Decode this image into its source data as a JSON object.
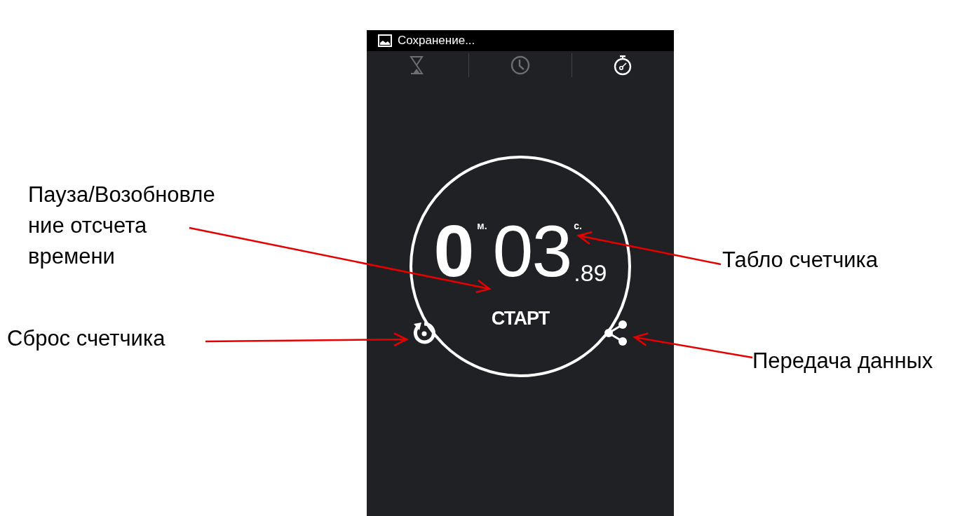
{
  "status_bar": {
    "notification": "Сохранение..."
  },
  "tabs": [
    {
      "kind": "timer",
      "selected": false
    },
    {
      "kind": "clock",
      "selected": false
    },
    {
      "kind": "stopwatch",
      "selected": true
    }
  ],
  "stopwatch": {
    "minutes": "0",
    "minutes_unit": "м.",
    "seconds": "03",
    "seconds_unit": "с.",
    "hundredths": ".89",
    "start_button": "СТАРТ"
  },
  "annotations": [
    {
      "kind": "start",
      "text": "Пауза/Возобновле\nние отсчета\nвремени"
    },
    {
      "kind": "display",
      "text": "Табло счетчика"
    },
    {
      "kind": "reset",
      "text": "Сброс счетчика"
    },
    {
      "kind": "share",
      "text": "Передача данных"
    }
  ]
}
